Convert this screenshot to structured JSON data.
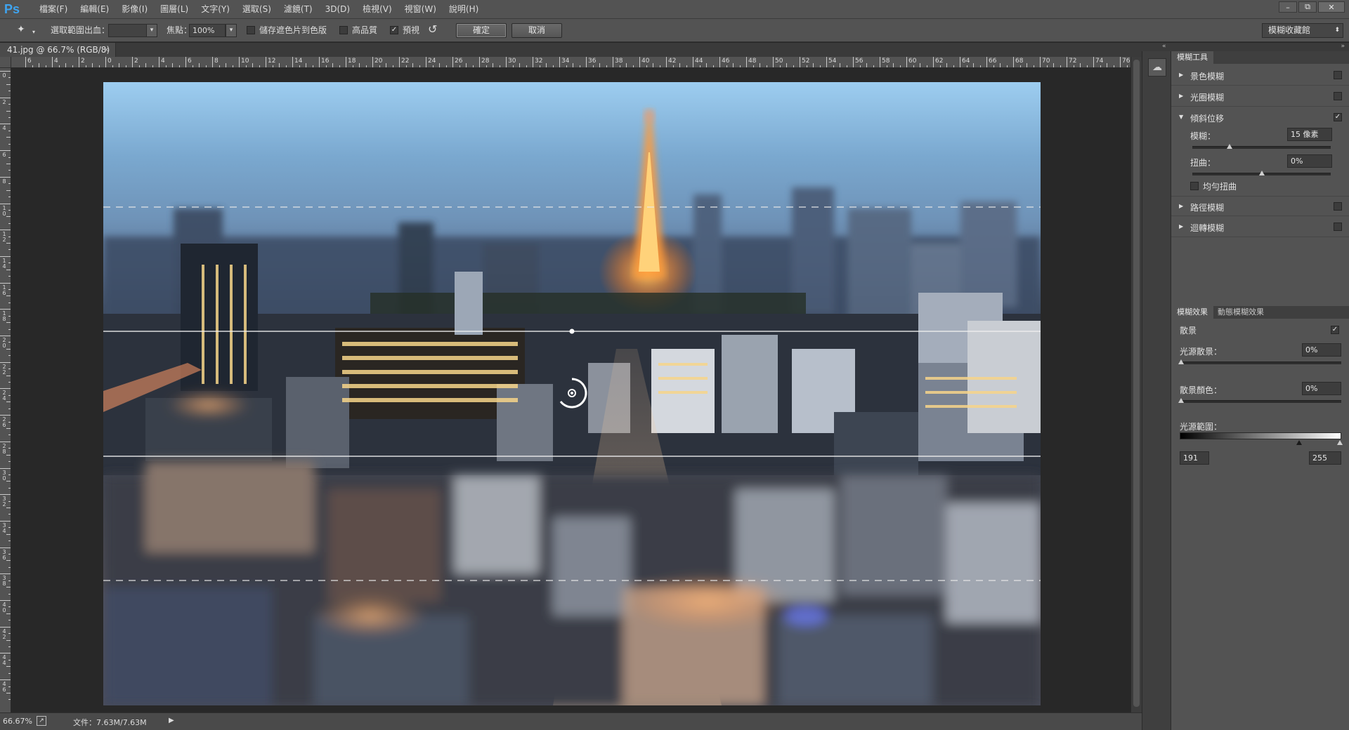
{
  "menubar": {
    "logo": "Ps",
    "items": [
      "檔案(F)",
      "編輯(E)",
      "影像(I)",
      "圖層(L)",
      "文字(Y)",
      "選取(S)",
      "濾鏡(T)",
      "3D(D)",
      "檢視(V)",
      "視窗(W)",
      "說明(H)"
    ],
    "window_controls": [
      "–",
      "⧉",
      "✕"
    ]
  },
  "options": {
    "selection_label": "選取範圍出血：",
    "selection_value": "",
    "focus_label": "焦點：",
    "focus_value": "100%",
    "save_mask_label": "儲存遮色片到色版",
    "save_mask_checked": false,
    "high_quality_label": "高品質",
    "high_quality_checked": false,
    "preview_label": "預視",
    "preview_checked": true,
    "ok_label": "確定",
    "cancel_label": "取消",
    "workspace_preset": "模糊收藏館"
  },
  "document": {
    "tab_title": "41.jpg @ 66.7% (RGB/8)",
    "tab_close": "×"
  },
  "rulers": {
    "horizontal_labels": [
      "6",
      "4",
      "2",
      "0",
      "2",
      "4",
      "6",
      "8",
      "10",
      "12",
      "14",
      "16",
      "18",
      "20",
      "22",
      "24",
      "26",
      "28",
      "30",
      "32",
      "34",
      "36",
      "38",
      "40",
      "42",
      "44",
      "46",
      "48",
      "50",
      "52",
      "54",
      "56",
      "58",
      "60",
      "62",
      "64",
      "66",
      "68",
      "70",
      "72",
      "74",
      "76"
    ],
    "vertical_labels": [
      "0",
      "2",
      "4",
      "6",
      "8",
      "10",
      "12",
      "14",
      "16",
      "18",
      "20",
      "22",
      "24",
      "26",
      "28",
      "30",
      "32",
      "34",
      "36",
      "38",
      "40",
      "42",
      "44",
      "46"
    ]
  },
  "status": {
    "zoom": "66.67%",
    "doc_info": "文件：7.63M/7.63M",
    "arrow": "▶"
  },
  "blur_tools": {
    "tab_label": "模糊工具",
    "items": [
      {
        "label": "景色模糊",
        "checked": false,
        "expanded": false
      },
      {
        "label": "光圈模糊",
        "checked": false,
        "expanded": false
      },
      {
        "label": "傾斜位移",
        "checked": true,
        "expanded": true
      },
      {
        "label": "路徑模糊",
        "checked": false,
        "expanded": false
      },
      {
        "label": "迴轉模糊",
        "checked": false,
        "expanded": false
      }
    ],
    "tilt_shift": {
      "blur_label": "模糊：",
      "blur_value": "15 像素",
      "blur_slider": 0.27,
      "distortion_label": "扭曲：",
      "distortion_value": "0%",
      "distortion_slider": 0.5,
      "symmetric_label": "均勻扭曲",
      "symmetric_checked": false
    }
  },
  "blur_effects": {
    "tab_effects": "模糊效果",
    "tab_motion": "動態模糊效果",
    "bokeh_label": "散景",
    "bokeh_checked": true,
    "light_bokeh_label": "光源散景：",
    "light_bokeh_value": "0%",
    "bokeh_color_label": "散景顏色：",
    "bokeh_color_value": "0%",
    "light_range_label": "光源範圍：",
    "light_range_low": "191",
    "light_range_high": "255"
  },
  "icons": {
    "arrow": "arrow-icon",
    "cc": "creative-cloud-icon",
    "reset": "reset-icon",
    "pin": "pin-icon"
  }
}
